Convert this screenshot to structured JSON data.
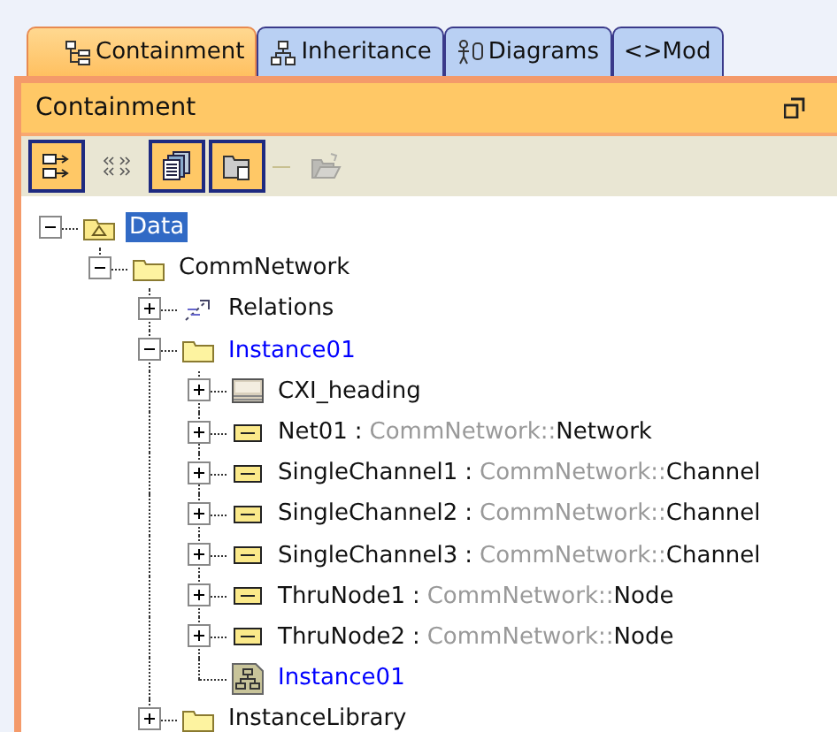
{
  "tabs": [
    {
      "label": "Containment",
      "kind": "containment",
      "selected": true
    },
    {
      "label": "Inheritance",
      "kind": "inheritance",
      "selected": false
    },
    {
      "label": "Diagrams",
      "kind": "diagrams",
      "selected": false
    },
    {
      "label": "<>Mod",
      "kind": "model",
      "selected": false
    }
  ],
  "panel": {
    "title": "Containment"
  },
  "toolbar": [
    {
      "kind": "expand",
      "pressed": true,
      "disabled": false
    },
    {
      "kind": "arrows",
      "pressed": false,
      "disabled": false
    },
    {
      "kind": "documents",
      "pressed": true,
      "disabled": false
    },
    {
      "kind": "window",
      "pressed": true,
      "disabled": false
    },
    {
      "kind": "open",
      "pressed": false,
      "disabled": true
    }
  ],
  "tree": [
    {
      "label": "Data",
      "kind": "package",
      "selected": true,
      "expanded": true,
      "children": [
        {
          "label": "CommNetwork",
          "kind": "folder",
          "selected": false,
          "expanded": true,
          "children": [
            {
              "label": "Relations",
              "kind": "relations",
              "selected": false,
              "expanded": false
            },
            {
              "label": "Instance01",
              "kind": "folder",
              "color": "#0000ff",
              "selected": false,
              "expanded": true,
              "children": [
                {
                  "label": "CXI_heading",
                  "kind": "picture",
                  "selected": false,
                  "expanded": false
                },
                {
                  "label": "Net01",
                  "separator": ":",
                  "qualifier": "CommNetwork::",
                  "type": "Network",
                  "kind": "part",
                  "selected": false,
                  "expanded": false
                },
                {
                  "label": "SingleChannel1",
                  "separator": ":",
                  "qualifier": "CommNetwork::",
                  "type": "Channel",
                  "kind": "part",
                  "selected": false,
                  "expanded": false
                },
                {
                  "label": "SingleChannel2",
                  "separator": ":",
                  "qualifier": "CommNetwork::",
                  "type": "Channel",
                  "kind": "part",
                  "selected": false,
                  "expanded": false
                },
                {
                  "label": "SingleChannel3",
                  "separator": ":",
                  "qualifier": "CommNetwork::",
                  "type": "Channel",
                  "kind": "part",
                  "selected": false,
                  "expanded": false
                },
                {
                  "label": "ThruNode1",
                  "separator": ":",
                  "qualifier": "CommNetwork::",
                  "type": "Node",
                  "kind": "part",
                  "selected": false,
                  "expanded": false
                },
                {
                  "label": "ThruNode2",
                  "separator": ":",
                  "qualifier": "CommNetwork::",
                  "type": "Node",
                  "kind": "part",
                  "selected": false,
                  "expanded": false
                },
                {
                  "label": "Instance01",
                  "kind": "diagram",
                  "color": "#0000ff",
                  "selected": false
                }
              ]
            },
            {
              "label": "InstanceLibrary",
              "kind": "folder",
              "selected": false,
              "expanded": false
            }
          ]
        }
      ]
    }
  ]
}
